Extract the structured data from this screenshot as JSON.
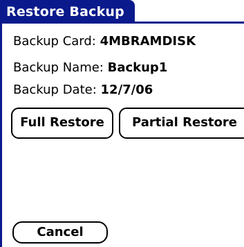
{
  "dialog": {
    "title": "Restore Backup"
  },
  "info": {
    "backup_card_label": "Backup Card:",
    "backup_card_value": "4MBRAMDISK",
    "backup_name_label": "Backup Name:",
    "backup_name_value": "Backup1",
    "backup_date_label": "Backup Date:",
    "backup_date_value": "12/7/06"
  },
  "buttons": {
    "full_restore": "Full Restore",
    "partial_restore": "Partial Restore",
    "cancel": "Cancel"
  },
  "colors": {
    "title_bar": "#0a1a8c",
    "title_text": "#ffffff",
    "background": "#ffffff",
    "text": "#000000"
  }
}
